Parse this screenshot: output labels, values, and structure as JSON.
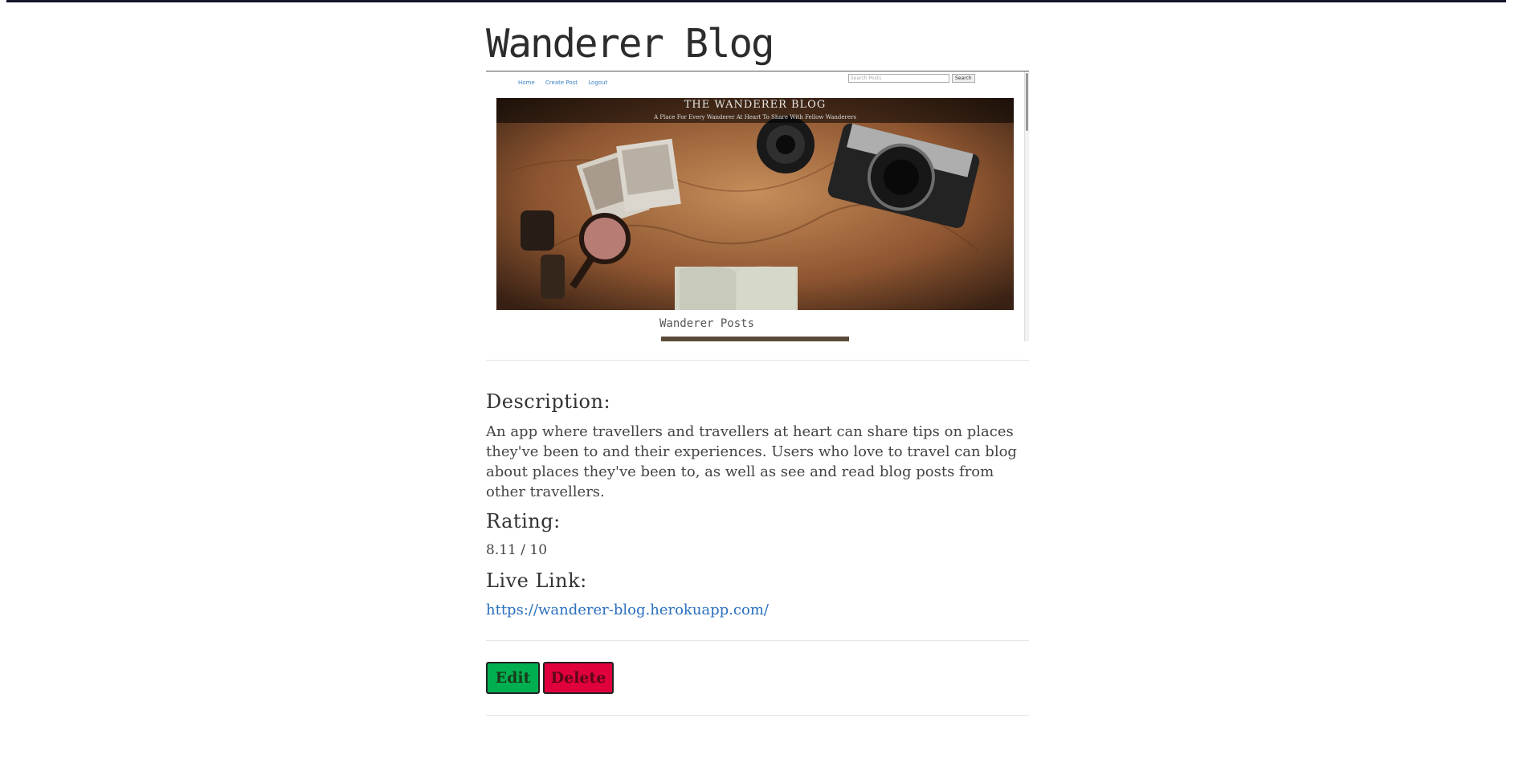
{
  "page": {
    "title": "Wanderer Blog"
  },
  "preview": {
    "nav": [
      "Home",
      "Create Post",
      "Logout"
    ],
    "search_placeholder": "Search Posts",
    "search_button": "Search",
    "hero_title": "THE WANDERER BLOG",
    "hero_subtitle": "A Place For Every Wanderer At Heart To Share With Fellow Wanderers",
    "section_title": "Wanderer Posts"
  },
  "details": {
    "description_heading": "Description:",
    "description": "An app where travellers and travellers at heart can share tips on places they've been to and their experiences. Users who love to travel can blog about places they've been to, as well as see and read blog posts from other travellers.",
    "rating_heading": "Rating:",
    "rating": "8.11 / 10",
    "link_heading": "Live Link:",
    "link": "https://wanderer-blog.herokuapp.com/"
  },
  "actions": {
    "edit_label": "Edit",
    "delete_label": "Delete"
  },
  "colors": {
    "edit": "#00b050",
    "delete": "#e0003c",
    "link": "#2a6fbf"
  }
}
